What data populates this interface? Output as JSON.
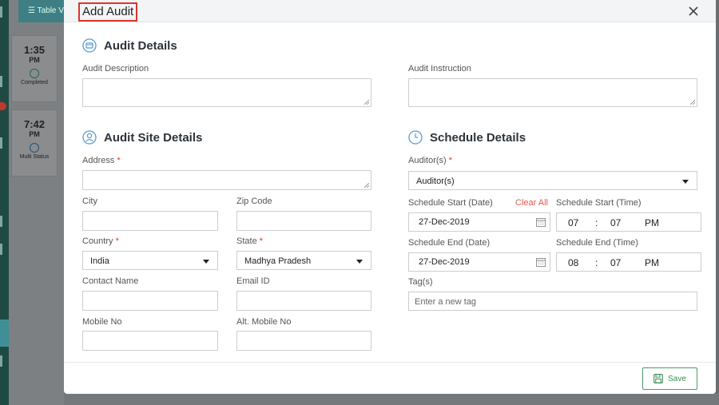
{
  "background": {
    "top_button_label": "Table V",
    "cards": [
      {
        "time": "1:35",
        "ampm": "PM",
        "status": "Completed"
      },
      {
        "time": "7:42",
        "ampm": "PM",
        "status": "Multi Status"
      }
    ]
  },
  "modal": {
    "title": "Add Audit",
    "save_label": "Save"
  },
  "audit_details": {
    "title": "Audit Details",
    "description_label": "Audit Description",
    "description_value": "",
    "instruction_label": "Audit Instruction",
    "instruction_value": ""
  },
  "site_details": {
    "title": "Audit Site Details",
    "address_label": "Address",
    "address_value": "",
    "city_label": "City",
    "zip_label": "Zip Code",
    "country_label": "Country",
    "country_value": "India",
    "state_label": "State",
    "state_value": "Madhya Pradesh",
    "contact_label": "Contact Name",
    "email_label": "Email ID",
    "mobile_label": "Mobile No",
    "alt_mobile_label": "Alt. Mobile No",
    "required_mark": "*"
  },
  "schedule": {
    "title": "Schedule Details",
    "auditors_label": "Auditor(s)",
    "auditors_value": "Auditor(s)",
    "start_date_label": "Schedule Start (Date)",
    "clear_all": "Clear All",
    "start_time_label": "Schedule Start (Time)",
    "start_date": "27-Dec-2019",
    "start_hour": "07",
    "start_min": "07",
    "start_ampm": "PM",
    "end_date_label": "Schedule End (Date)",
    "end_time_label": "Schedule End (Time)",
    "end_date": "27-Dec-2019",
    "end_hour": "08",
    "end_min": "07",
    "end_ampm": "PM",
    "time_sep": ":",
    "tags_label": "Tag(s)",
    "tags_placeholder": "Enter a new tag"
  },
  "colors": {
    "accent_red": "#d9362b",
    "save_green": "#3a8c55",
    "icon_blue": "#5a9bd4"
  }
}
